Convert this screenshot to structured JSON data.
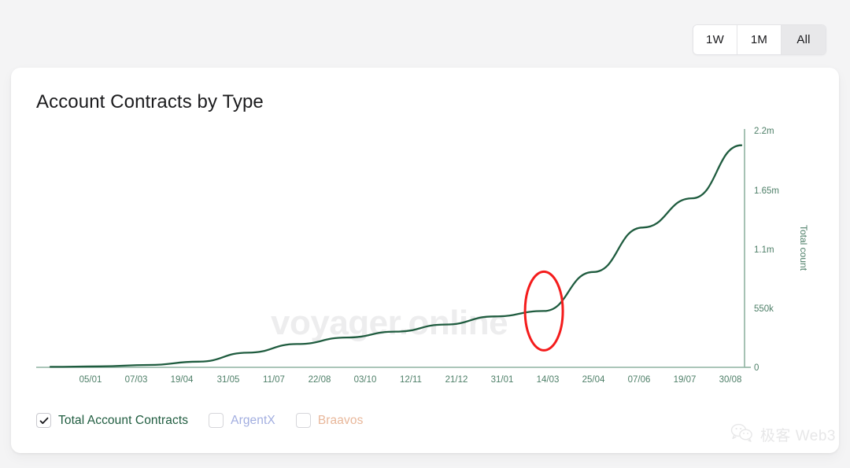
{
  "range_toggle": {
    "options": [
      {
        "label": "1W",
        "active": false
      },
      {
        "label": "1M",
        "active": false
      },
      {
        "label": "All",
        "active": true
      }
    ]
  },
  "card": {
    "title": "Account Contracts by Type",
    "watermark": "voyager.online"
  },
  "legend": [
    {
      "label": "Total Account Contracts",
      "checked": true,
      "color": "#1f5c3f"
    },
    {
      "label": "ArgentX",
      "checked": false,
      "color": "#a2aee0"
    },
    {
      "label": "Braavos",
      "checked": false,
      "color": "#e8b79a"
    }
  ],
  "branding": {
    "watermark_text": "极客 Web3",
    "icon": "wechat-icon"
  },
  "colors": {
    "page_background": "#f4f4f5",
    "card_background": "#ffffff",
    "line": "#1f5c3f",
    "axis": "#8fb3a2",
    "axis_text": "#4e7f68",
    "annotation": "#f41c1c",
    "watermark": "#ededee"
  },
  "chart_data": {
    "type": "line",
    "title": "Account Contracts by Type",
    "xlabel": "",
    "ylabel": "Total count",
    "grid": false,
    "legend_position": "bottom-left",
    "y_axis_side": "right",
    "ylim": [
      0,
      2200000
    ],
    "yticks": [
      0,
      550000,
      1100000,
      1650000,
      2200000
    ],
    "ytick_labels": [
      "0",
      "550k",
      "1.1m",
      "1.65m",
      "2.2m"
    ],
    "xtick_labels": [
      "05/01",
      "07/03",
      "19/04",
      "31/05",
      "11/07",
      "22/08",
      "03/10",
      "12/11",
      "21/12",
      "31/01",
      "14/03",
      "25/04",
      "07/06",
      "19/07",
      "30/08"
    ],
    "series": [
      {
        "name": "Total Account Contracts",
        "color": "#1f5c3f",
        "visible": true,
        "x": [
          "05/01",
          "07/03",
          "19/04",
          "31/05",
          "11/07",
          "22/08",
          "03/10",
          "12/11",
          "21/12",
          "31/01",
          "14/03",
          "25/04",
          "07/06",
          "19/07",
          "30/08"
        ],
        "values": [
          4000,
          9000,
          22000,
          52000,
          135000,
          215000,
          275000,
          330000,
          395000,
          470000,
          520000,
          880000,
          1290000,
          1560000,
          2050000
        ]
      },
      {
        "name": "ArgentX",
        "color": "#a2aee0",
        "visible": false,
        "values": []
      },
      {
        "name": "Braavos",
        "color": "#e8b79a",
        "visible": false,
        "values": []
      }
    ],
    "annotations": [
      {
        "type": "ellipse",
        "label": "inflection-highlight",
        "color": "#f41c1c",
        "center_x": "14/03",
        "center_y": 520000
      }
    ]
  }
}
